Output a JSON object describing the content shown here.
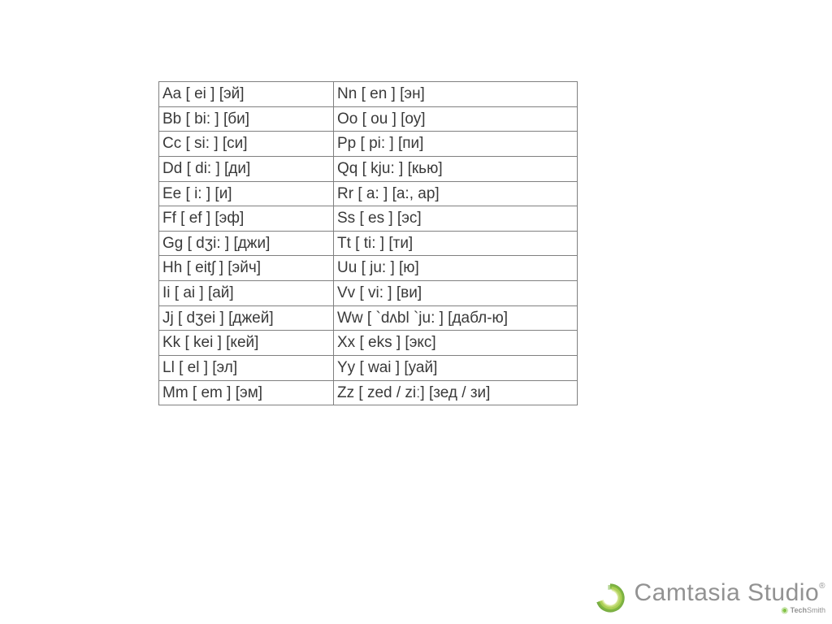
{
  "alphabet_rows": [
    {
      "left": "Aa [ ei ] [эй]",
      "right": "Nn [ en ] [эн]"
    },
    {
      "left": "Bb [ bi: ] [би]",
      "right": "Oo [ ou ] [оу]"
    },
    {
      "left": "Cc [ si: ] [си]",
      "right": "Pp [ pi: ] [пи]"
    },
    {
      "left": "Dd [ di: ] [ди]",
      "right": "Qq [ kju: ] [кью]"
    },
    {
      "left": "Ee [ i: ] [и]",
      "right": "Rr [ a: ] [а:, ар]"
    },
    {
      "left": "Ff [ ef ] [эф]",
      "right": "Ss [ es ] [эс]"
    },
    {
      "left": "Gg [ dʒi: ] [джи]",
      "right": "Tt [ ti: ] [ти]"
    },
    {
      "left": "Hh [ eitʃ ] [эйч]",
      "right": "Uu [ ju: ] [ю]"
    },
    {
      "left": "Ii [ ai ] [ай]",
      "right": "Vv [ vi: ] [ви]"
    },
    {
      "left": "Jj [ dʒei ] [джей]",
      "right": "Ww [ `dʌbl `ju: ] [дабл-ю]"
    },
    {
      "left": "Kk [ kei ] [кей]",
      "right": "Xx [ eks ] [экс]"
    },
    {
      "left": "Ll [ el ] [эл]",
      "right": "Yy [ wai ] [уай]"
    },
    {
      "left": "Mm [ em ] [эм]",
      "right": "Zz [ zed / ziː] [зед / зи]"
    }
  ],
  "watermark": {
    "title": "Camtasia Studio",
    "reg": "®",
    "sub_prefix": "",
    "sub_brand1": "Tech",
    "sub_brand2": "Smith"
  }
}
